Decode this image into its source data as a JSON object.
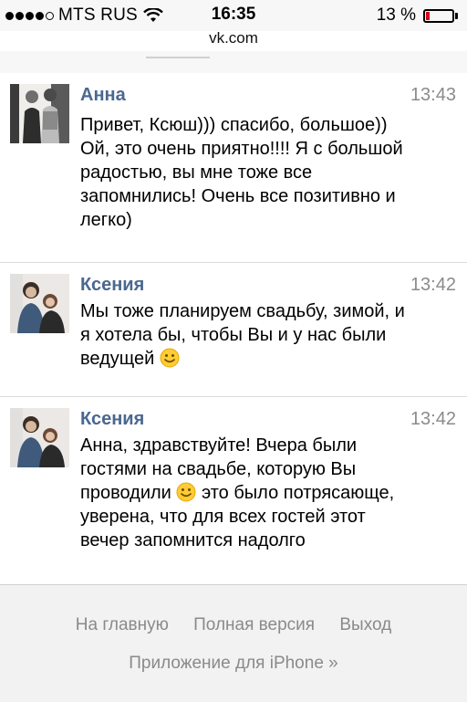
{
  "status_bar": {
    "carrier": "MTS RUS",
    "time": "16:35",
    "battery": "13 %",
    "battery_level": 0.13,
    "signal_bars": 4,
    "signal_total": 5
  },
  "browser": {
    "url": "vk.com"
  },
  "messages": [
    {
      "name": "Анна",
      "time": "13:43",
      "lines": [
        "Привет, Ксюш))) спасибо, большое))",
        "Ой, это очень приятно!!!! Я с большой",
        "радостью, вы мне тоже все",
        "запомнились! Очень все позитивно и",
        "легко)"
      ]
    },
    {
      "name": "Ксения",
      "time": "13:42",
      "lines": [
        "Мы тоже планируем свадьбу, зимой, и",
        "я хотела бы, чтобы Вы и у нас были",
        "ведущей"
      ]
    },
    {
      "name": "Ксения",
      "time": "13:42",
      "lines": [
        "Анна, здравствуйте! Вчера были",
        "гостями на свадьбе, которую Вы",
        "проводили",
        "это было потрясающе,",
        "уверена, что для всех гостей этот",
        "вечер запомнится надолго"
      ]
    }
  ],
  "footer": {
    "home": "На главную",
    "full_version": "Полная версия",
    "logout": "Выход",
    "app": "Приложение для iPhone »"
  },
  "icons": [
    "wifi-icon",
    "battery-icon",
    "smile-emoji-icon"
  ]
}
